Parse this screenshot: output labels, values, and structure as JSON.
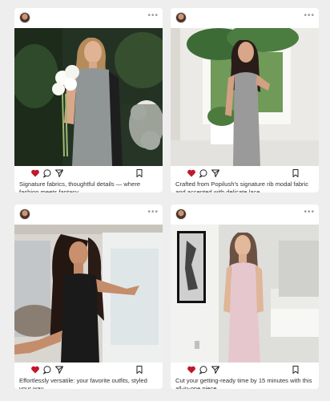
{
  "posts": [
    {
      "caption": "Signature fabrics, thoughtful details — where fashion meets fantasy.",
      "avatar": "avatar",
      "more_icon": "more-icon",
      "liked": true
    },
    {
      "caption": "Crafted from Popilush's signature rib modal fabric and accented with delicate lace.",
      "avatar": "avatar",
      "more_icon": "more-icon",
      "liked": true
    },
    {
      "caption": "Effortlessly versatile: your favorite outfits, styled your way.",
      "avatar": "avatar",
      "more_icon": "more-icon",
      "liked": true
    },
    {
      "caption": "Cut your getting-ready time by 15 minutes with this all-in-one piece.",
      "avatar": "avatar",
      "more_icon": "more-icon",
      "liked": true
    }
  ],
  "colors": {
    "heart": "#c0182a",
    "background": "#eeeeee",
    "card": "#ffffff"
  },
  "more_glyph": "•••"
}
